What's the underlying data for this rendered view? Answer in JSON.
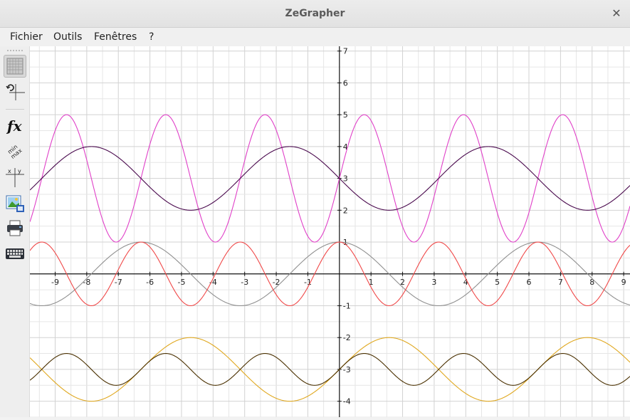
{
  "window": {
    "title": "ZeGrapher"
  },
  "menubar": {
    "items": [
      "Fichier",
      "Outils",
      "Fenêtres",
      "?"
    ]
  },
  "toolbar": {
    "items": [
      {
        "name": "grid-tool",
        "icon": "grid-icon",
        "active": true
      },
      {
        "name": "view-reset-tool",
        "icon": "axes-reset-icon"
      },
      {
        "name": "functions-tool",
        "icon": "fx-icon",
        "label": "fx"
      },
      {
        "name": "range-tool",
        "icon": "minmax-icon"
      },
      {
        "name": "data-tool",
        "icon": "xy-table-icon"
      },
      {
        "name": "export-image-tool",
        "icon": "image-export-icon"
      },
      {
        "name": "print-tool",
        "icon": "printer-icon"
      },
      {
        "name": "keyboard-tool",
        "icon": "keyboard-icon"
      }
    ]
  },
  "chart_data": {
    "type": "line",
    "xlim": [
      -9.8,
      9.2
    ],
    "ylim": [
      -4.5,
      7.15
    ],
    "grid": true,
    "x_ticks": [
      "-9",
      "-8",
      "-7",
      "-6",
      "-5",
      "-4",
      "-3",
      "-2",
      "-1",
      "1",
      "2",
      "3",
      "4",
      "5",
      "6",
      "7",
      "8",
      "9"
    ],
    "y_ticks": [
      "7",
      "6",
      "5",
      "4",
      "3",
      "2",
      "1",
      "-1",
      "-2",
      "-3",
      "-4"
    ],
    "series": [
      {
        "color": "#e040c8",
        "formula": "3 + 2·sin(2x)",
        "amp": 2,
        "freq": 2,
        "shift": 3
      },
      {
        "color": "#4a0a4e",
        "formula": "3 - sin(x)",
        "amp": -1,
        "freq": 1,
        "shift": 3
      },
      {
        "color": "#909090",
        "formula": "cos(x)",
        "amp": 1,
        "freq": 1,
        "shift": 0,
        "kind": "cos"
      },
      {
        "color": "#f04848",
        "formula": "cos(2x)",
        "amp": 1,
        "freq": 2,
        "shift": 0,
        "kind": "cos"
      },
      {
        "color": "#e0a820",
        "formula": "-3 + sin(x)",
        "amp": 1,
        "freq": 1,
        "shift": -3
      },
      {
        "color": "#4a3000",
        "formula": "-3 + 0.5·sin(2x)",
        "amp": 0.5,
        "freq": 2,
        "shift": -3
      }
    ]
  }
}
